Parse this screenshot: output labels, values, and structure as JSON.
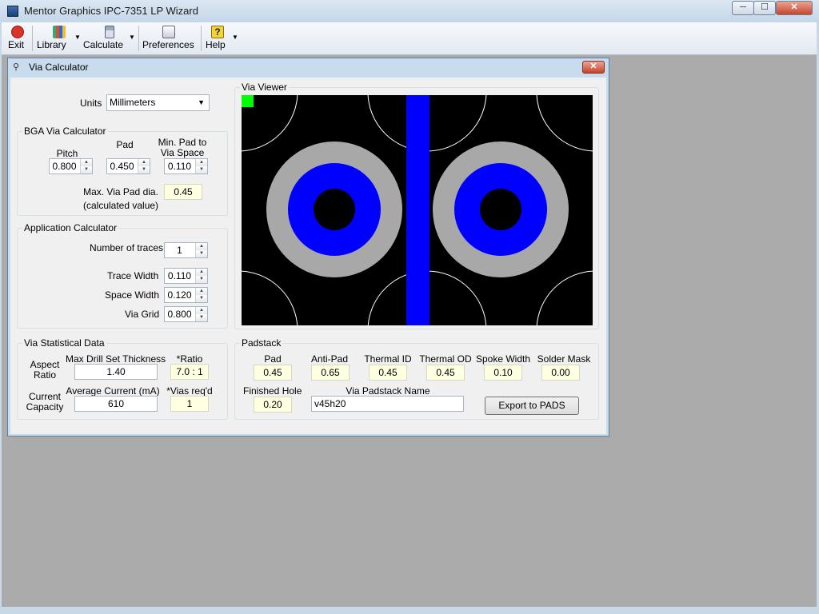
{
  "window": {
    "title": "Mentor Graphics IPC-7351 LP Wizard",
    "minimize": "─",
    "maximize": "☐",
    "close": "✕"
  },
  "toolbar": {
    "exit": "Exit",
    "library": "Library",
    "calculate": "Calculate",
    "preferences": "Preferences",
    "help": "Help"
  },
  "dialog": {
    "title": "Via Calculator",
    "close": "✕"
  },
  "units": {
    "label": "Units",
    "value": "Millimeters"
  },
  "bga": {
    "title": "BGA Via Calculator",
    "pitch_label": "Pitch",
    "pitch": "0.800",
    "pad_label": "Pad",
    "pad": "0.450",
    "minpad_label_1": "Min. Pad to",
    "minpad_label_2": "Via Space",
    "minpad": "0.110",
    "maxvia_label_1": "Max. Via Pad dia.",
    "maxvia_label_2": "(calculated value)",
    "maxvia": "0.45"
  },
  "app": {
    "title": "Application Calculator",
    "traces_label": "Number of traces",
    "traces": "1",
    "trace_width_label": "Trace Width",
    "trace_width": "0.110",
    "space_width_label": "Space Width",
    "space_width": "0.120",
    "via_grid_label": "Via Grid",
    "via_grid": "0.800"
  },
  "viewer": {
    "title": "Via Viewer"
  },
  "stats": {
    "title": "Via Statistical Data",
    "aspect_label_1": "Aspect",
    "aspect_label_2": "Ratio",
    "maxdrill_label": "Max Drill Set Thickness",
    "maxdrill": "1.40",
    "ratio_label": "*Ratio",
    "ratio": "7.0 : 1",
    "current_label_1": "Current",
    "current_label_2": "Capacity",
    "avgcurrent_label": "Average Current (mA)",
    "avgcurrent": "610",
    "vias_label": "*Vias req'd",
    "vias": "1"
  },
  "padstack": {
    "title": "Padstack",
    "pad_label": "Pad",
    "pad": "0.45",
    "antipad_label": "Anti-Pad",
    "antipad": "0.65",
    "thermalid_label": "Thermal ID",
    "thermalid": "0.45",
    "thermalod_label": "Thermal OD",
    "thermalod": "0.45",
    "spoke_label": "Spoke Width",
    "spoke": "0.10",
    "mask_label": "Solder Mask",
    "mask": "0.00",
    "hole_label": "Finished Hole",
    "hole": "0.20",
    "name_label": "Via Padstack Name",
    "name": "v45h20",
    "export": "Export to PADS"
  },
  "colors": {
    "viewer_bg": "#000000",
    "via_pad": "#0000ff",
    "anti_pad": "#a8a8a8",
    "trace": "#0000ff",
    "marker": "#00ff00"
  }
}
